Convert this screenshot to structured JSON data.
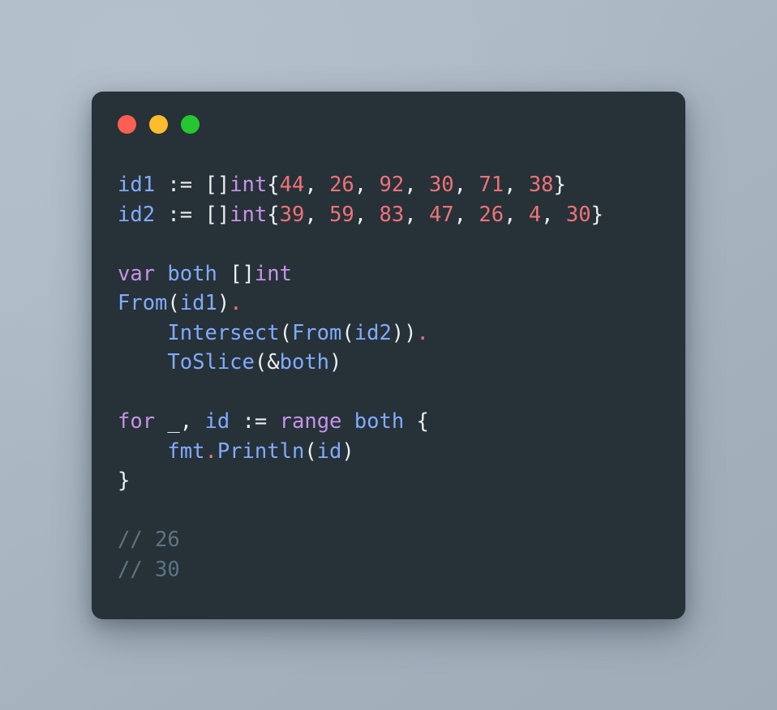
{
  "window": {
    "controls": [
      {
        "name": "close",
        "color": "#ff5f52"
      },
      {
        "name": "minimize",
        "color": "#fbbc2e"
      },
      {
        "name": "maximize",
        "color": "#25c632"
      }
    ]
  },
  "theme": {
    "card_background": "#263238",
    "page_background": "#aab6c2",
    "plain": "#eceff1",
    "keyword": "#c792ea",
    "identifier": "#82aaff",
    "number": "#f07178",
    "comment": "#5c7481"
  },
  "code": {
    "language": "go",
    "lines": [
      {
        "id": "line-1",
        "text": "id1 := []int{44, 26, 92, 30, 71, 38}",
        "tokens": [
          {
            "t": "id1",
            "c": "t-ident"
          },
          {
            "t": " := ",
            "c": "t-op"
          },
          {
            "t": "[]",
            "c": "t-punct"
          },
          {
            "t": "int",
            "c": "t-type"
          },
          {
            "t": "{",
            "c": "t-punct"
          },
          {
            "t": "44",
            "c": "t-num"
          },
          {
            "t": ", ",
            "c": "t-punct"
          },
          {
            "t": "26",
            "c": "t-num"
          },
          {
            "t": ", ",
            "c": "t-punct"
          },
          {
            "t": "92",
            "c": "t-num"
          },
          {
            "t": ", ",
            "c": "t-punct"
          },
          {
            "t": "30",
            "c": "t-num"
          },
          {
            "t": ", ",
            "c": "t-punct"
          },
          {
            "t": "71",
            "c": "t-num"
          },
          {
            "t": ", ",
            "c": "t-punct"
          },
          {
            "t": "38",
            "c": "t-num"
          },
          {
            "t": "}",
            "c": "t-punct"
          }
        ]
      },
      {
        "id": "line-2",
        "text": "id2 := []int{39, 59, 83, 47, 26, 4, 30}",
        "tokens": [
          {
            "t": "id2",
            "c": "t-ident"
          },
          {
            "t": " := ",
            "c": "t-op"
          },
          {
            "t": "[]",
            "c": "t-punct"
          },
          {
            "t": "int",
            "c": "t-type"
          },
          {
            "t": "{",
            "c": "t-punct"
          },
          {
            "t": "39",
            "c": "t-num"
          },
          {
            "t": ", ",
            "c": "t-punct"
          },
          {
            "t": "59",
            "c": "t-num"
          },
          {
            "t": ", ",
            "c": "t-punct"
          },
          {
            "t": "83",
            "c": "t-num"
          },
          {
            "t": ", ",
            "c": "t-punct"
          },
          {
            "t": "47",
            "c": "t-num"
          },
          {
            "t": ", ",
            "c": "t-punct"
          },
          {
            "t": "26",
            "c": "t-num"
          },
          {
            "t": ", ",
            "c": "t-punct"
          },
          {
            "t": "4",
            "c": "t-num"
          },
          {
            "t": ", ",
            "c": "t-punct"
          },
          {
            "t": "30",
            "c": "t-num"
          },
          {
            "t": "}",
            "c": "t-punct"
          }
        ]
      },
      {
        "id": "line-3",
        "text": "",
        "tokens": []
      },
      {
        "id": "line-4",
        "text": "var both []int",
        "tokens": [
          {
            "t": "var",
            "c": "t-kw"
          },
          {
            "t": " ",
            "c": "t-plain"
          },
          {
            "t": "both",
            "c": "t-ident"
          },
          {
            "t": " ",
            "c": "t-plain"
          },
          {
            "t": "[]",
            "c": "t-punct"
          },
          {
            "t": "int",
            "c": "t-type"
          }
        ]
      },
      {
        "id": "line-5",
        "text": "From(id1).",
        "tokens": [
          {
            "t": "From",
            "c": "t-fn"
          },
          {
            "t": "(",
            "c": "t-punct"
          },
          {
            "t": "id1",
            "c": "t-ident"
          },
          {
            "t": ")",
            "c": "t-punct"
          },
          {
            "t": ".",
            "c": "t-dot"
          }
        ]
      },
      {
        "id": "line-6",
        "text": "    Intersect(From(id2)).",
        "tokens": [
          {
            "t": "    ",
            "c": "t-plain"
          },
          {
            "t": "Intersect",
            "c": "t-fn"
          },
          {
            "t": "(",
            "c": "t-punct"
          },
          {
            "t": "From",
            "c": "t-fn"
          },
          {
            "t": "(",
            "c": "t-punct"
          },
          {
            "t": "id2",
            "c": "t-ident"
          },
          {
            "t": "))",
            "c": "t-punct"
          },
          {
            "t": ".",
            "c": "t-dot"
          }
        ]
      },
      {
        "id": "line-7",
        "text": "    ToSlice(&both)",
        "tokens": [
          {
            "t": "    ",
            "c": "t-plain"
          },
          {
            "t": "ToSlice",
            "c": "t-fn"
          },
          {
            "t": "(&",
            "c": "t-punct"
          },
          {
            "t": "both",
            "c": "t-ident"
          },
          {
            "t": ")",
            "c": "t-punct"
          }
        ]
      },
      {
        "id": "line-8",
        "text": "",
        "tokens": []
      },
      {
        "id": "line-9",
        "text": "for _, id := range both {",
        "tokens": [
          {
            "t": "for",
            "c": "t-kw"
          },
          {
            "t": " _",
            "c": "t-plain"
          },
          {
            "t": ", ",
            "c": "t-punct"
          },
          {
            "t": "id",
            "c": "t-ident"
          },
          {
            "t": " := ",
            "c": "t-op"
          },
          {
            "t": "range",
            "c": "t-kw"
          },
          {
            "t": " ",
            "c": "t-plain"
          },
          {
            "t": "both",
            "c": "t-ident"
          },
          {
            "t": " {",
            "c": "t-punct"
          }
        ]
      },
      {
        "id": "line-10",
        "text": "    fmt.Println(id)",
        "tokens": [
          {
            "t": "    ",
            "c": "t-plain"
          },
          {
            "t": "fmt",
            "c": "t-ident"
          },
          {
            "t": ".",
            "c": "t-dot"
          },
          {
            "t": "Println",
            "c": "t-fn"
          },
          {
            "t": "(",
            "c": "t-punct"
          },
          {
            "t": "id",
            "c": "t-ident"
          },
          {
            "t": ")",
            "c": "t-punct"
          }
        ]
      },
      {
        "id": "line-11",
        "text": "}",
        "tokens": [
          {
            "t": "}",
            "c": "t-punct"
          }
        ]
      },
      {
        "id": "line-12",
        "text": "",
        "tokens": []
      },
      {
        "id": "line-13",
        "text": "// 26",
        "tokens": [
          {
            "t": "// 26",
            "c": "t-comment"
          }
        ]
      },
      {
        "id": "line-14",
        "text": "// 30",
        "tokens": [
          {
            "t": "// 30",
            "c": "t-comment"
          }
        ]
      }
    ]
  }
}
